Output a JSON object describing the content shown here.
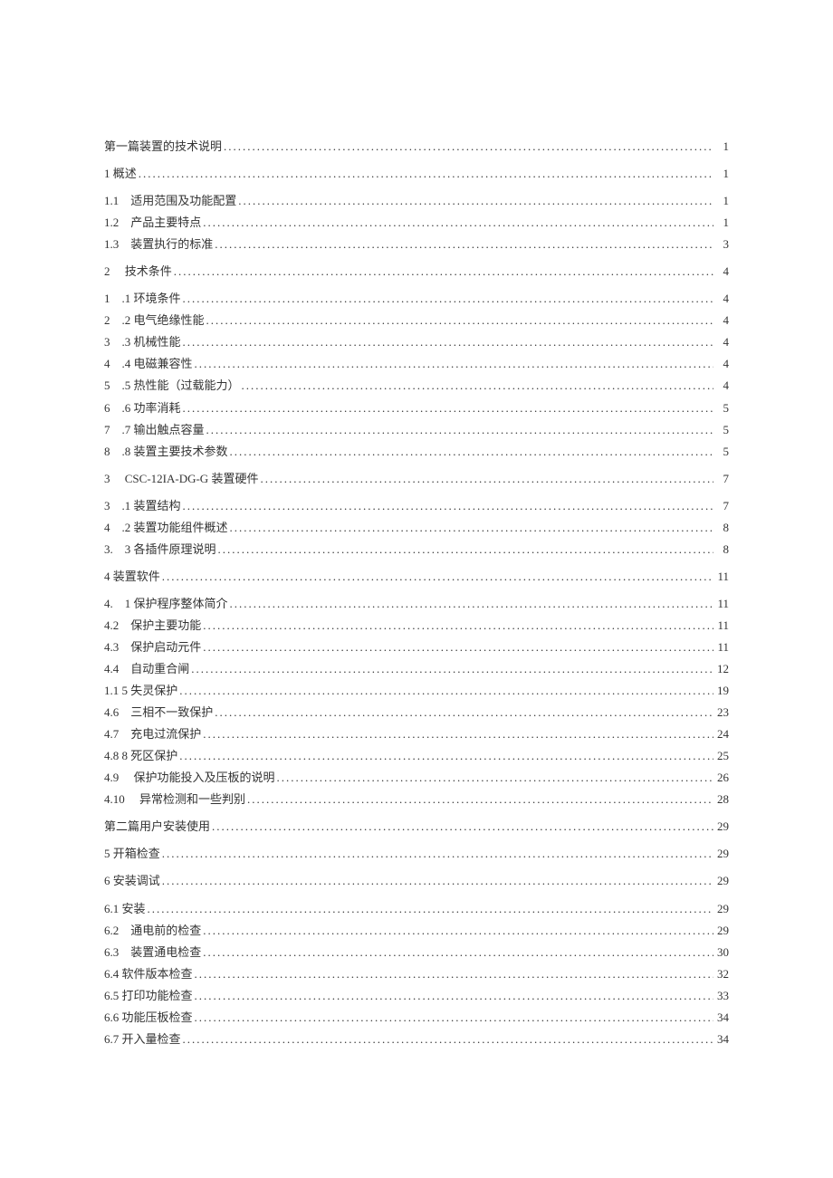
{
  "toc": [
    {
      "label": "第一篇装置的技术说明",
      "page": "1",
      "indent": 0
    },
    {
      "label": "1 概述",
      "page": "1",
      "indent": 0,
      "gap": true
    },
    {
      "label": "1.1　适用范围及功能配置",
      "page": "1",
      "indent": 0,
      "gap": true
    },
    {
      "label": "1.2　产品主要特点",
      "page": "1",
      "indent": 0
    },
    {
      "label": "1.3　装置执行的标准",
      "page": "3",
      "indent": 0
    },
    {
      "label": "2　  技术条件",
      "page": "4",
      "indent": 0,
      "gap": true
    },
    {
      "label": "1　.1 环境条件",
      "page": "4",
      "indent": 0,
      "gap": true
    },
    {
      "label": "2　.2 电气绝缘性能",
      "page": "4",
      "indent": 0
    },
    {
      "label": "3　.3 机械性能",
      "page": "4",
      "indent": 0
    },
    {
      "label": "4　.4 电磁兼容性",
      "page": "4",
      "indent": 0
    },
    {
      "label": "5　.5 热性能（过载能力）",
      "page": "4",
      "indent": 0
    },
    {
      "label": "6　.6 功率消耗",
      "page": "5",
      "indent": 0
    },
    {
      "label": "7　.7 输出触点容量",
      "page": "5",
      "indent": 0
    },
    {
      "label": "8　.8 装置主要技术参数",
      "page": "5",
      "indent": 0
    },
    {
      "label": "3　  CSC-12IA-DG-G 装置硬件",
      "page": "7",
      "indent": 0,
      "gap": true
    },
    {
      "label": "3　.1 装置结构",
      "page": "7",
      "indent": 0,
      "gap": true
    },
    {
      "label": "4　.2 装置功能组件概述",
      "page": "8",
      "indent": 0
    },
    {
      "label": "3.　3 各插件原理说明",
      "page": "8",
      "indent": 0
    },
    {
      "label": "4 装置软件",
      "page": "11",
      "indent": 0,
      "gap": true
    },
    {
      "label": "4.　1 保护程序整体简介",
      "page": "11",
      "indent": 0,
      "gap": true
    },
    {
      "label": "4.2　保护主要功能",
      "page": "11",
      "indent": 0
    },
    {
      "label": "4.3　保护启动元件",
      "page": "11",
      "indent": 0
    },
    {
      "label": "4.4　自动重合闸",
      "page": "12",
      "indent": 0
    },
    {
      "label": "1.1 5 失灵保护",
      "page": "19",
      "indent": 0
    },
    {
      "label": "4.6　三相不一致保护",
      "page": "23",
      "indent": 0
    },
    {
      "label": "4.7　充电过流保护",
      "page": "24",
      "indent": 0
    },
    {
      "label": "4.8 8 死区保护",
      "page": "25",
      "indent": 0
    },
    {
      "label": "4.9　 保护功能投入及压板的说明",
      "page": "26",
      "indent": 0
    },
    {
      "label": "4.10　 异常检测和一些判别",
      "page": "28",
      "indent": 0
    },
    {
      "label": "第二篇用户安装使用",
      "page": "29",
      "indent": 0,
      "gap": true
    },
    {
      "label": "5 开箱检查",
      "page": "29",
      "indent": 0,
      "gap": true
    },
    {
      "label": "6 安装调试",
      "page": "29",
      "indent": 0,
      "gap": true
    },
    {
      "label": "6.1 安装",
      "page": "29",
      "indent": 0,
      "gap": true
    },
    {
      "label": "6.2　通电前的检查",
      "page": "29",
      "indent": 0
    },
    {
      "label": "6.3　装置通电检查",
      "page": "30",
      "indent": 0
    },
    {
      "label": "6.4 软件版本检查",
      "page": "32",
      "indent": 0
    },
    {
      "label": "6.5 打印功能检查",
      "page": "33",
      "indent": 0
    },
    {
      "label": "6.6 功能压板检查",
      "page": "34",
      "indent": 0
    },
    {
      "label": "6.7 开入量检查",
      "page": "34",
      "indent": 0
    }
  ]
}
